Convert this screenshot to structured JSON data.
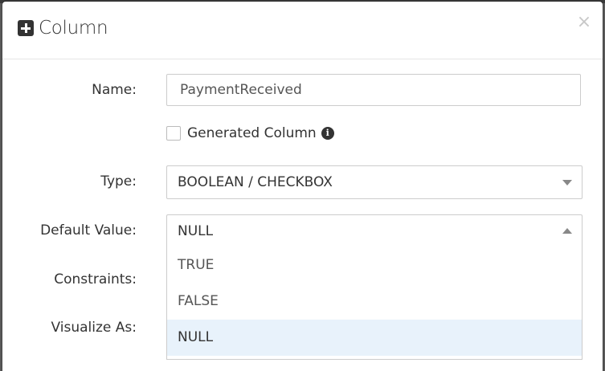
{
  "modal": {
    "title": "Column",
    "close_label": "×"
  },
  "form": {
    "name_label": "Name:",
    "name_value": "PaymentReceived",
    "generated_label": "Generated Column",
    "type_label": "Type:",
    "type_value": "BOOLEAN / CHECKBOX",
    "default_label": "Default Value:",
    "default_value": "NULL",
    "constraints_label": "Constraints:",
    "visualize_label": "Visualize As:"
  },
  "dropdown": {
    "options": [
      "TRUE",
      "FALSE",
      "NULL"
    ],
    "selected": "NULL"
  },
  "colors": {
    "selected_option_bg": "#e8f2fb",
    "border": "#cccccc",
    "text": "#333333"
  }
}
